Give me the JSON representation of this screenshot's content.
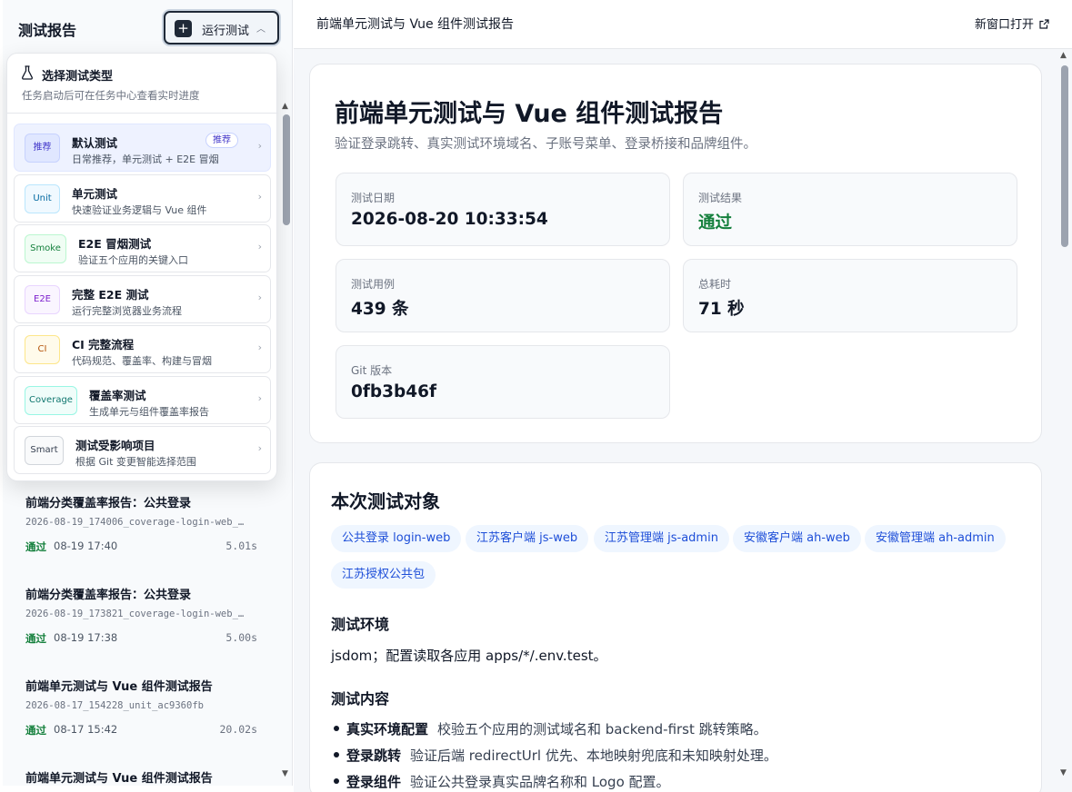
{
  "sidebar": {
    "title": "测试报告",
    "run_button": "运行测试",
    "reports": [
      {
        "title": "前端分类覆盖率报告：公共登录",
        "file": "2026-08-19_174006_coverage-login-web_…",
        "status": "通过",
        "date": "08-19 17:40",
        "duration": "5.01s"
      },
      {
        "title": "前端分类覆盖率报告：公共登录",
        "file": "2026-08-19_173821_coverage-login-web_…",
        "status": "通过",
        "date": "08-19 17:38",
        "duration": "5.00s"
      },
      {
        "title": "前端单元测试与 Vue 组件测试报告",
        "file": "2026-08-17_154228_unit_ac9360fb",
        "status": "通过",
        "date": "08-17 15:42",
        "duration": "20.02s"
      },
      {
        "title": "前端单元测试与 Vue 组件测试报告"
      }
    ]
  },
  "dropdown": {
    "title": "选择测试类型",
    "subtitle": "任务启动后可在任务中心查看实时进度",
    "options": [
      {
        "tag": "推荐",
        "name": "默认测试",
        "desc": "日常推荐，单元测试 + E2E 冒烟",
        "badge": "推荐",
        "tag_color": "#4338ca",
        "tag_bg": "#e0e7ff",
        "tag_border": "#c7d2fe"
      },
      {
        "tag": "Unit",
        "name": "单元测试",
        "desc": "快速验证业务逻辑与 Vue 组件",
        "tag_color": "#0369a1",
        "tag_bg": "#f0f9ff",
        "tag_border": "#bae6fd"
      },
      {
        "tag": "Smoke",
        "name": "E2E 冒烟测试",
        "desc": "验证五个应用的关键入口",
        "tag_color": "#15803d",
        "tag_bg": "#f0fdf4",
        "tag_border": "#bbf7d0"
      },
      {
        "tag": "E2E",
        "name": "完整 E2E 测试",
        "desc": "运行完整浏览器业务流程",
        "tag_color": "#7e22ce",
        "tag_bg": "#faf5ff",
        "tag_border": "#e9d5ff"
      },
      {
        "tag": "CI",
        "name": "CI 完整流程",
        "desc": "代码规范、覆盖率、构建与冒烟",
        "tag_color": "#b45309",
        "tag_bg": "#fffbeb",
        "tag_border": "#fde68a"
      },
      {
        "tag": "Coverage",
        "name": "覆盖率测试",
        "desc": "生成单元与组件覆盖率报告",
        "tag_color": "#0f766e",
        "tag_bg": "#f0fdfa",
        "tag_border": "#99f6e4"
      },
      {
        "tag": "Smart",
        "name": "测试受影响项目",
        "desc": "根据 Git 变更智能选择范围",
        "tag_color": "#374151",
        "tag_bg": "#f9fafb",
        "tag_border": "#d1d5db"
      }
    ]
  },
  "main": {
    "topbar_title": "前端单元测试与 Vue 组件测试报告",
    "open_new_window": "新窗口打开",
    "title": "前端单元测试与 Vue 组件测试报告",
    "subtitle": "验证登录跳转、真实测试环境域名、子账号菜单、登录桥接和品牌组件。",
    "stats": [
      {
        "label": "测试日期",
        "value": "2026-08-20 10:33:54"
      },
      {
        "label": "测试结果",
        "value": "通过"
      },
      {
        "label": "测试用例",
        "value": "439 条"
      },
      {
        "label": "总耗时",
        "value": "71 秒"
      },
      {
        "label": "Git 版本",
        "value": "0fb3b46f"
      }
    ],
    "targets_heading": "本次测试对象",
    "targets": [
      "公共登录 login-web",
      "江苏客户端 js-web",
      "江苏管理端 js-admin",
      "安徽客户端 ah-web",
      "安徽管理端 ah-admin",
      "江苏授权公共包"
    ],
    "env_heading": "测试环境",
    "env_text": "jsdom；配置读取各应用 apps/*/.env.test。",
    "content_heading": "测试内容",
    "content_items": [
      {
        "label": "真实环境配置",
        "text": "校验五个应用的测试域名和 backend-first 跳转策略。"
      },
      {
        "label": "登录跳转",
        "text": "验证后端 redirectUrl 优先、本地映射兜底和未知映射处理。"
      },
      {
        "label": "登录组件",
        "text": "验证公共登录真实品牌名称和 Logo 配置。"
      }
    ]
  }
}
